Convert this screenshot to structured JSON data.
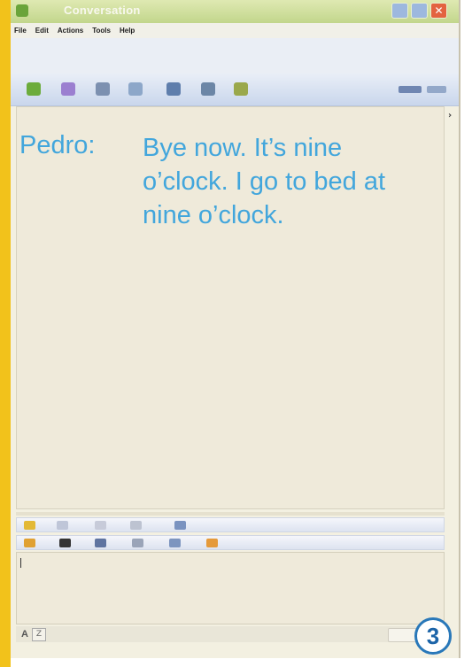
{
  "window": {
    "title": "Conversation",
    "controls": {
      "close": "✕"
    }
  },
  "menu": [
    "File",
    "Edit",
    "Actions",
    "Tools",
    "Help"
  ],
  "toolbar_icons": [
    "invite-contact-icon",
    "send-files-icon",
    "webcam-icon",
    "call-icon",
    "share-folder-icon",
    "activities-icon",
    "games-icon",
    "draw-icon",
    "more-options-icon"
  ],
  "conversation": {
    "speaker": "Pedro:",
    "message": "Bye now. It’s nine o’clock. I go to bed at nine o’clock."
  },
  "format_icons": {
    "row1": [
      "emoticon-icon",
      "wink-icon",
      "nudge-icon",
      "voice-clip-icon",
      "image-icon"
    ],
    "row2": [
      "emoticon-smile-icon",
      "emoticon-face-icon",
      "headset-icon",
      "webcam-small-icon",
      "background-icon",
      "emoticon-gift-icon"
    ]
  },
  "input_bar": {
    "font_label": "A",
    "handwriting_label": "Z"
  },
  "page_badge": "3",
  "colors": {
    "accent_strip": "#f2c21b",
    "message_text": "#42a6dc",
    "badge": "#2978b9"
  }
}
